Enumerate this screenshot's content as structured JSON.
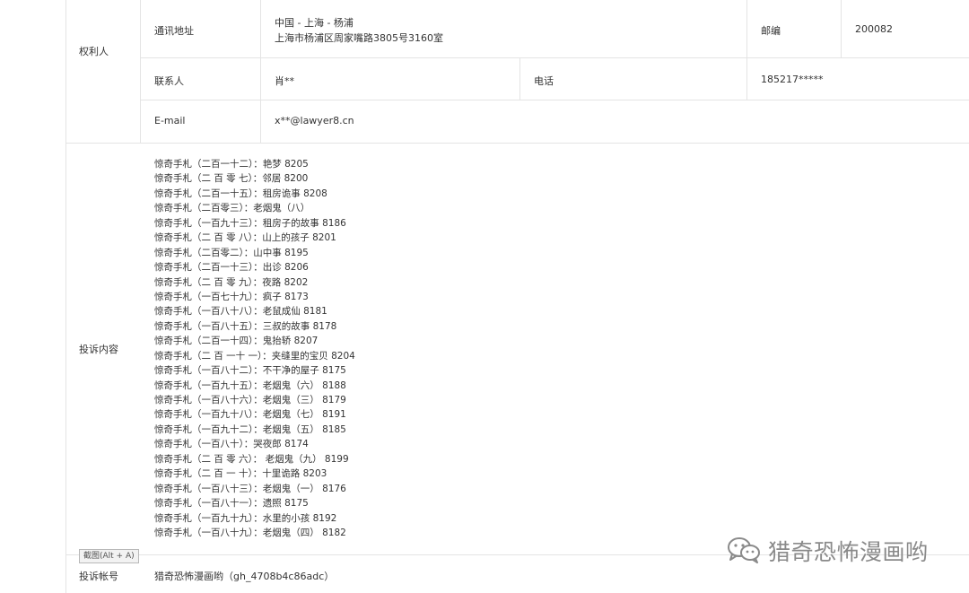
{
  "owner": {
    "section_label": "权利人",
    "address_label": "通讯地址",
    "address_line1": "中国 - 上海 - 杨浦",
    "address_line2": "上海市杨浦区周家嘴路3805号3160室",
    "postcode_label": "邮编",
    "postcode": "200082",
    "contact_label": "联系人",
    "contact": "肖**",
    "phone_label": "电话",
    "phone": "185217*****",
    "email_label": "E-mail",
    "email": "x**@lawyer8.cn"
  },
  "complaint": {
    "label": "投诉内容",
    "items": [
      "惊奇手札（二百一十二）：艳梦 8205",
      "惊奇手札（二 百 零 七）：邻居  8200",
      "惊奇手札（二百一十五）：租房诡事 8208",
      "惊奇手札（二百零三）：老烟鬼（八）",
      "惊奇手札（一百九十三）：租房子的故事  8186",
      "惊奇手札（二 百 零 八）：山上的孩子  8201",
      "惊奇手札（二百零二）：山中事  8195",
      "惊奇手札（二百一十三）：出诊 8206",
      "惊奇手札（二 百 零 九）：夜路  8202",
      "惊奇手札（一百七十九）：疯子    8173",
      "惊奇手札（一百八十八）：老鼠成仙  8181",
      "惊奇手札（一百八十五）：三叔的故事  8178",
      "惊奇手札（二百一十四）：鬼抬轿 8207",
      "惊奇手札（二 百 一十 一）：夹缝里的宝贝 8204",
      "惊奇手札（一百八十二）：不干净的屋子  8175",
      "惊奇手札（一百九十五）：老烟鬼（六）  8188",
      "惊奇手札（一百八十六）：老烟鬼（三）  8179",
      "惊奇手札（一百九十八）：老烟鬼（七）  8191",
      "惊奇手札（一百九十二）：老烟鬼（五）  8185",
      "惊奇手札（一百八十）：哭夜郎  8174",
      "惊奇手札（二  百  零 六）：  老烟鬼（九）  8199",
      "惊奇手札（二 百 一  十）：十里诡路 8203",
      "惊奇手札（一百八十三）：老烟鬼（一）   8176",
      "惊奇手札（一百八十一）：遗照 8175",
      "惊奇手札（一百九十九）：水里的小孩  8192",
      "惊奇手札（一百八十九）：老烟鬼（四）  8182"
    ]
  },
  "account": {
    "label": "投诉帐号",
    "value": "猎奇恐怖漫画哟（gh_4708b4c86adc）"
  },
  "tooltip": "截图(Alt + A)",
  "watermark": {
    "text": "猎奇恐怖漫画哟",
    "icon": "wechat-icon"
  },
  "colors": {
    "border": "#e4e4e4",
    "text": "#333333",
    "watermark": "#8a8a8a"
  }
}
